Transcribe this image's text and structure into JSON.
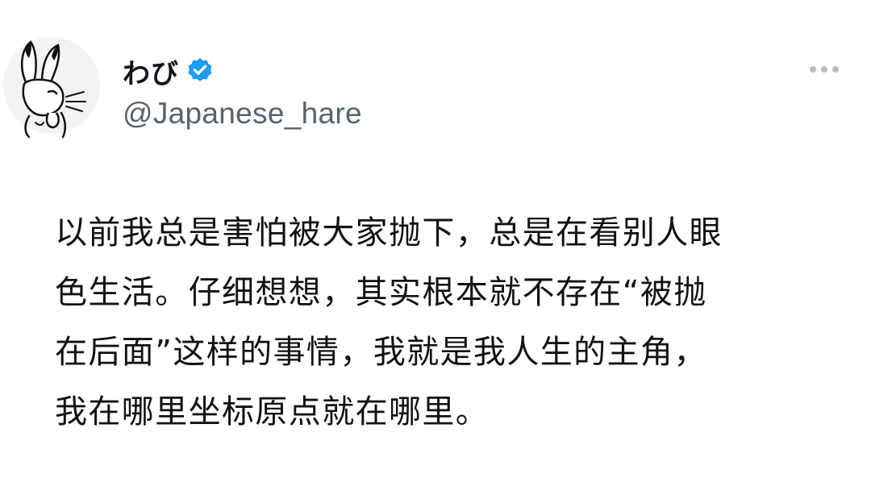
{
  "user": {
    "display_name": "わび",
    "handle": "@Japanese_hare",
    "verified": true,
    "avatar_icon": "rabbit-drawing-icon",
    "verified_icon": "verified-badge-icon",
    "verified_color": "#1d9bf0"
  },
  "menu": {
    "icon": "more-options-icon"
  },
  "post": {
    "lines": [
      "以前我总是害怕被大家抛下，总是在看别人眼",
      "色生活。仔细想想，其实根本就不存在“被抛",
      "在后面”这样的事情，我就是我人生的主角，",
      "我在哪里坐标原点就在哪里。"
    ]
  }
}
